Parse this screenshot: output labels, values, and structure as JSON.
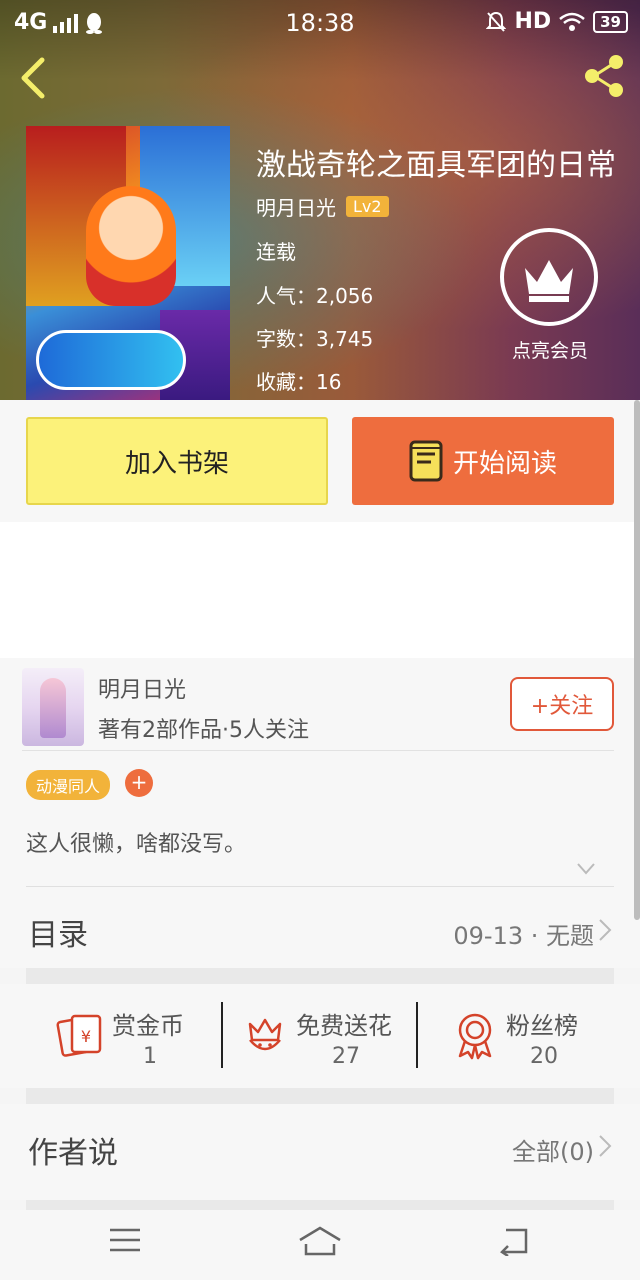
{
  "status_bar": {
    "network": "4G",
    "time": "18:38",
    "hd": "HD",
    "battery": "39"
  },
  "book": {
    "title": "激战奇轮之面具军团的日常",
    "author": "明月日光",
    "level": "Lv2",
    "status": "连载",
    "popularity": "人气：2,056",
    "words": "字数：3,745",
    "favorites": "收藏：16",
    "vip_label": "点亮会员"
  },
  "actions": {
    "add_shelf": "加入书架",
    "start_reading": "开始阅读"
  },
  "author_card": {
    "name": "明月日光",
    "stats": "著有2部作品·5人关注",
    "follow": "+关注",
    "tag": "动漫同人",
    "tag_add": "+",
    "bio": "这人很懒，啥都没写。"
  },
  "toc": {
    "label": "目录",
    "latest": "09-13 · 无题"
  },
  "stats": [
    {
      "name": "赏金币",
      "value": "1",
      "icon": "red-envelope-icon"
    },
    {
      "name": "免费送花",
      "value": "27",
      "icon": "flower-icon"
    },
    {
      "name": "粉丝榜",
      "value": "20",
      "icon": "medal-icon"
    }
  ],
  "author_says": {
    "label": "作者说",
    "all": "全部(0)"
  },
  "colors": {
    "accent_orange": "#ee6d3e",
    "shelf_yellow": "#fcf27a",
    "tag_gold": "#f2b33a",
    "icon_red": "#d4432a"
  }
}
